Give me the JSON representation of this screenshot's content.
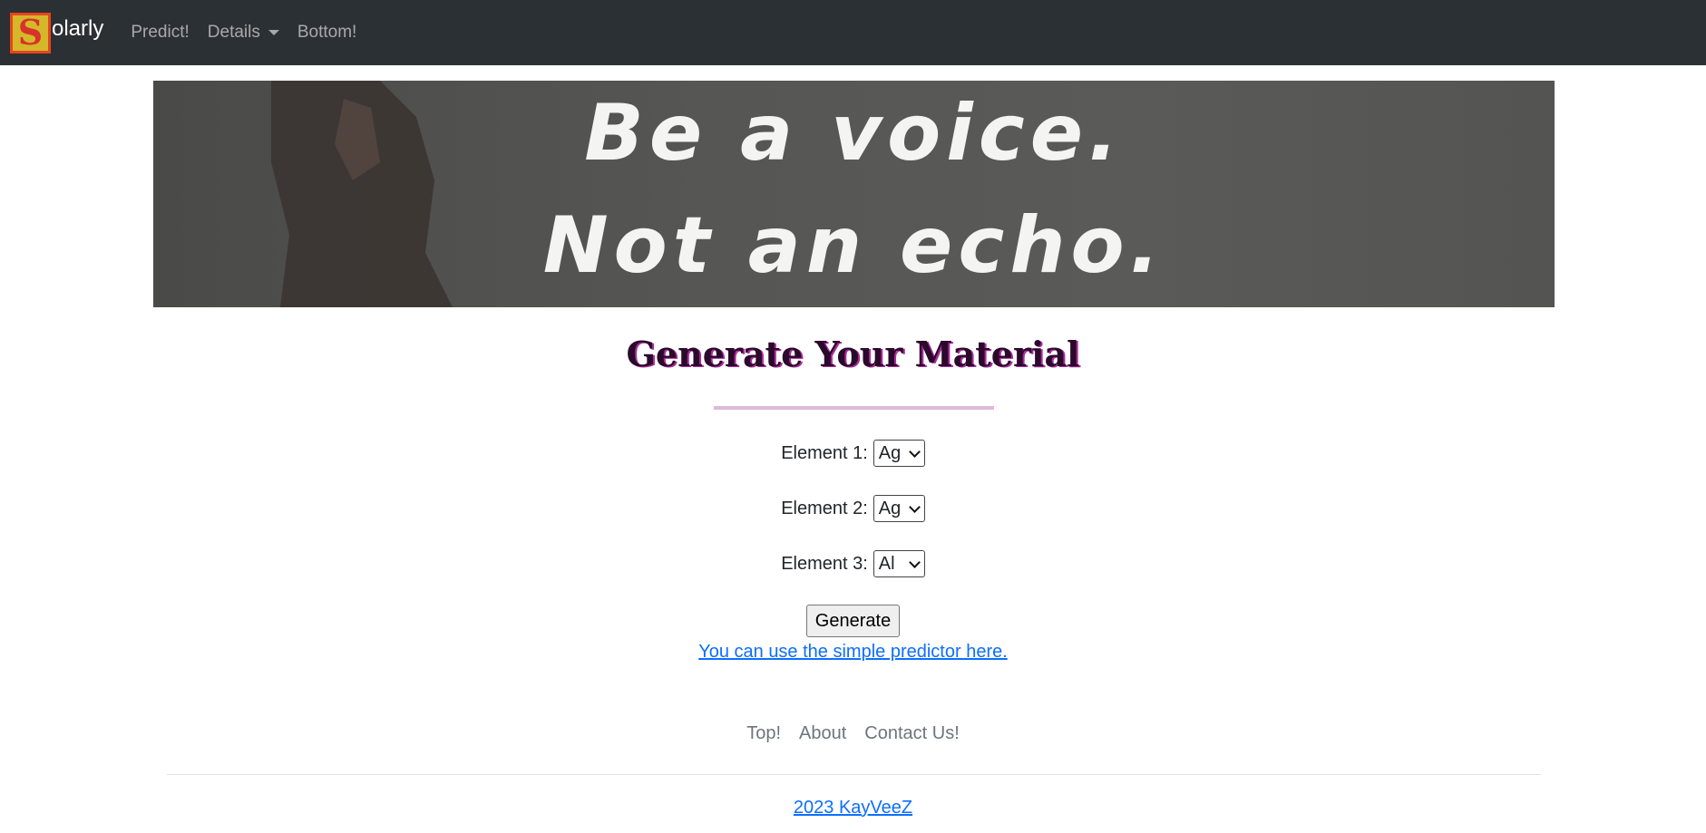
{
  "nav": {
    "logo_letter": "S",
    "brand_text": "olarly",
    "links": [
      "Predict!",
      "Details",
      "Bottom!"
    ]
  },
  "banner": {
    "line1": "Be a voice.",
    "line2": "Not an echo."
  },
  "main": {
    "title": "Generate Your Material",
    "fields": [
      {
        "label": "Element 1:",
        "value": "Ag"
      },
      {
        "label": "Element 2:",
        "value": "Ag"
      },
      {
        "label": "Element 3:",
        "value": "Al"
      }
    ],
    "generate_label": "Generate",
    "predictor_link": "You can use the simple predictor here."
  },
  "footer": {
    "links": [
      "Top!",
      "About",
      "Contact Us!"
    ],
    "copyright": "2023 KayVeeZ"
  },
  "colors": {
    "navbar": "#2b3035",
    "link": "#0d6efd",
    "divider": "#dcbad9",
    "title": "#2a0a2a"
  }
}
